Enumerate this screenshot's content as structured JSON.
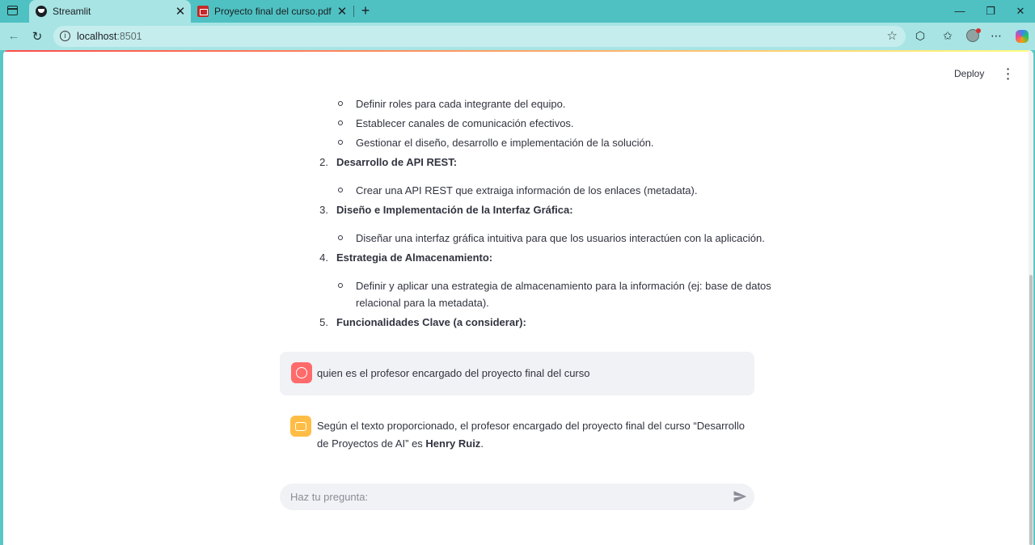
{
  "browser": {
    "tabs": [
      {
        "title": "Streamlit",
        "icon": "streamlit-icon",
        "active": true
      },
      {
        "title": "Proyecto final del curso.pdf",
        "icon": "pdf-icon",
        "active": false
      }
    ],
    "url_host": "localhost",
    "url_port": ":8501"
  },
  "app": {
    "deploy_label": "Deploy",
    "list": {
      "sub_1": [
        "Definir roles para cada integrante del equipo.",
        "Establecer canales de comunicación efectivos.",
        "Gestionar el diseño, desarrollo e implementación de la solución."
      ],
      "items": [
        {
          "num": "2.",
          "title": "Desarrollo de API REST:",
          "sub": [
            "Crear una API REST que extraiga información de los enlaces (metadata)."
          ]
        },
        {
          "num": "3.",
          "title": "Diseño e Implementación de la Interfaz Gráfica:",
          "sub": [
            "Diseñar una interfaz gráfica intuitiva para que los usuarios interactúen con la aplicación."
          ]
        },
        {
          "num": "4.",
          "title": "Estrategia de Almacenamiento:",
          "sub": [
            "Definir y aplicar una estrategia de almacenamiento para la información (ej: base de datos",
            "relacional para la metadata)."
          ]
        },
        {
          "num": "5.",
          "title": "Funcionalidades Clave (a considerar):"
        }
      ]
    },
    "user_message": "quien es el profesor encargado del proyecto final del curso",
    "assistant_message": {
      "prefix": "Según el texto proporcionado, el profesor encargado del proyecto final del curso “Desarrollo de Proyectos de AI” es ",
      "bold": "Henry Ruiz",
      "suffix": "."
    },
    "chat_input_placeholder": "Haz tu pregunta:"
  },
  "colors": {
    "browser_frame": "#58c7c8",
    "user_avatar": "#ff6b6b",
    "assistant_avatar": "#ffbd45",
    "chat_bg": "#f0f2f6"
  }
}
